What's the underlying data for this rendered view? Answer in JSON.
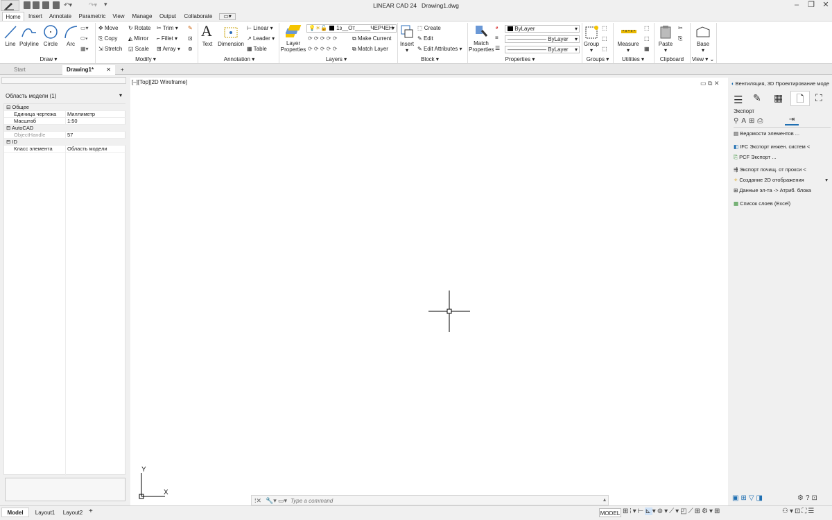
{
  "window": {
    "app_title": "LINEAR CAD 24",
    "file_name": "Drawing1.dwg"
  },
  "ribbon_tabs": [
    "Home",
    "Insert",
    "Annotate",
    "Parametric",
    "View",
    "Manage",
    "Output",
    "Collaborate"
  ],
  "panels": {
    "draw": {
      "title": "Draw",
      "line": "Line",
      "polyline": "Polyline",
      "circle": "Circle",
      "arc": "Arc"
    },
    "modify": {
      "title": "Modify",
      "move": "Move",
      "rotate": "Rotate",
      "trim": "Trim",
      "copy": "Copy",
      "mirror": "Mirror",
      "fillet": "Fillet",
      "stretch": "Stretch",
      "scale": "Scale",
      "array": "Array"
    },
    "annotation": {
      "title": "Annotation",
      "text": "Text",
      "dimension": "Dimension",
      "linear": "Linear",
      "leader": "Leader",
      "table": "Table"
    },
    "layers": {
      "title": "Layers",
      "layer_properties_1": "Layer",
      "layer_properties_2": "Properties",
      "current_layer": "1з__От_____ЧЕРЧЕН",
      "make_current": "Make Current",
      "match_layer": "Match Layer"
    },
    "block": {
      "title": "Block",
      "insert": "Insert",
      "create": "Create",
      "edit": "Edit",
      "edit_attributes": "Edit Attributes"
    },
    "properties": {
      "title": "Properties",
      "match_1": "Match",
      "match_2": "Properties",
      "color": "ByLayer",
      "linetype": "ByLayer",
      "lineweight": "ByLayer"
    },
    "groups": {
      "title": "Groups",
      "group": "Group"
    },
    "utilities": {
      "title": "Utilities",
      "measure": "Measure"
    },
    "clipboard": {
      "title": "Clipboard",
      "paste": "Paste"
    },
    "view": {
      "title": "View",
      "base": "Base"
    }
  },
  "doc_tabs": {
    "start": "Start",
    "drawing": "Drawing1*"
  },
  "left_panel": {
    "selector": "Область модели (1)",
    "groups": {
      "general": "Общее",
      "autocad": "AutoCAD",
      "id": "ID"
    },
    "rows": {
      "unit_label": "Единица чертежа",
      "unit_value": "Миллиметр",
      "scale_label": "Масштаб",
      "scale_value": "1:50",
      "handle_label": "ObjectHandle",
      "handle_value": "57",
      "class_label": "Класс элемента",
      "class_value": "Область модели"
    }
  },
  "viewport": {
    "label": "[–][Top][2D Wireframe]",
    "axis_y": "Y",
    "axis_x": "X"
  },
  "right_panel": {
    "title": "Вентиляция, 3D Проектирование моде",
    "section": "Экспорт",
    "items": [
      "Ведомости элементов ...",
      "IFC Экспорт инжен. систем <",
      "PCF Экспорт ...",
      "Экспорт почищ. от прокси <",
      "Создание 2D отображения",
      "Данные эл-та -> Атриб. блока",
      "Список слоев (Excel)"
    ]
  },
  "command": {
    "placeholder": "Type a command"
  },
  "layout_tabs": [
    "Model",
    "Layout1",
    "Layout2"
  ],
  "status": {
    "model": "MODEL"
  }
}
